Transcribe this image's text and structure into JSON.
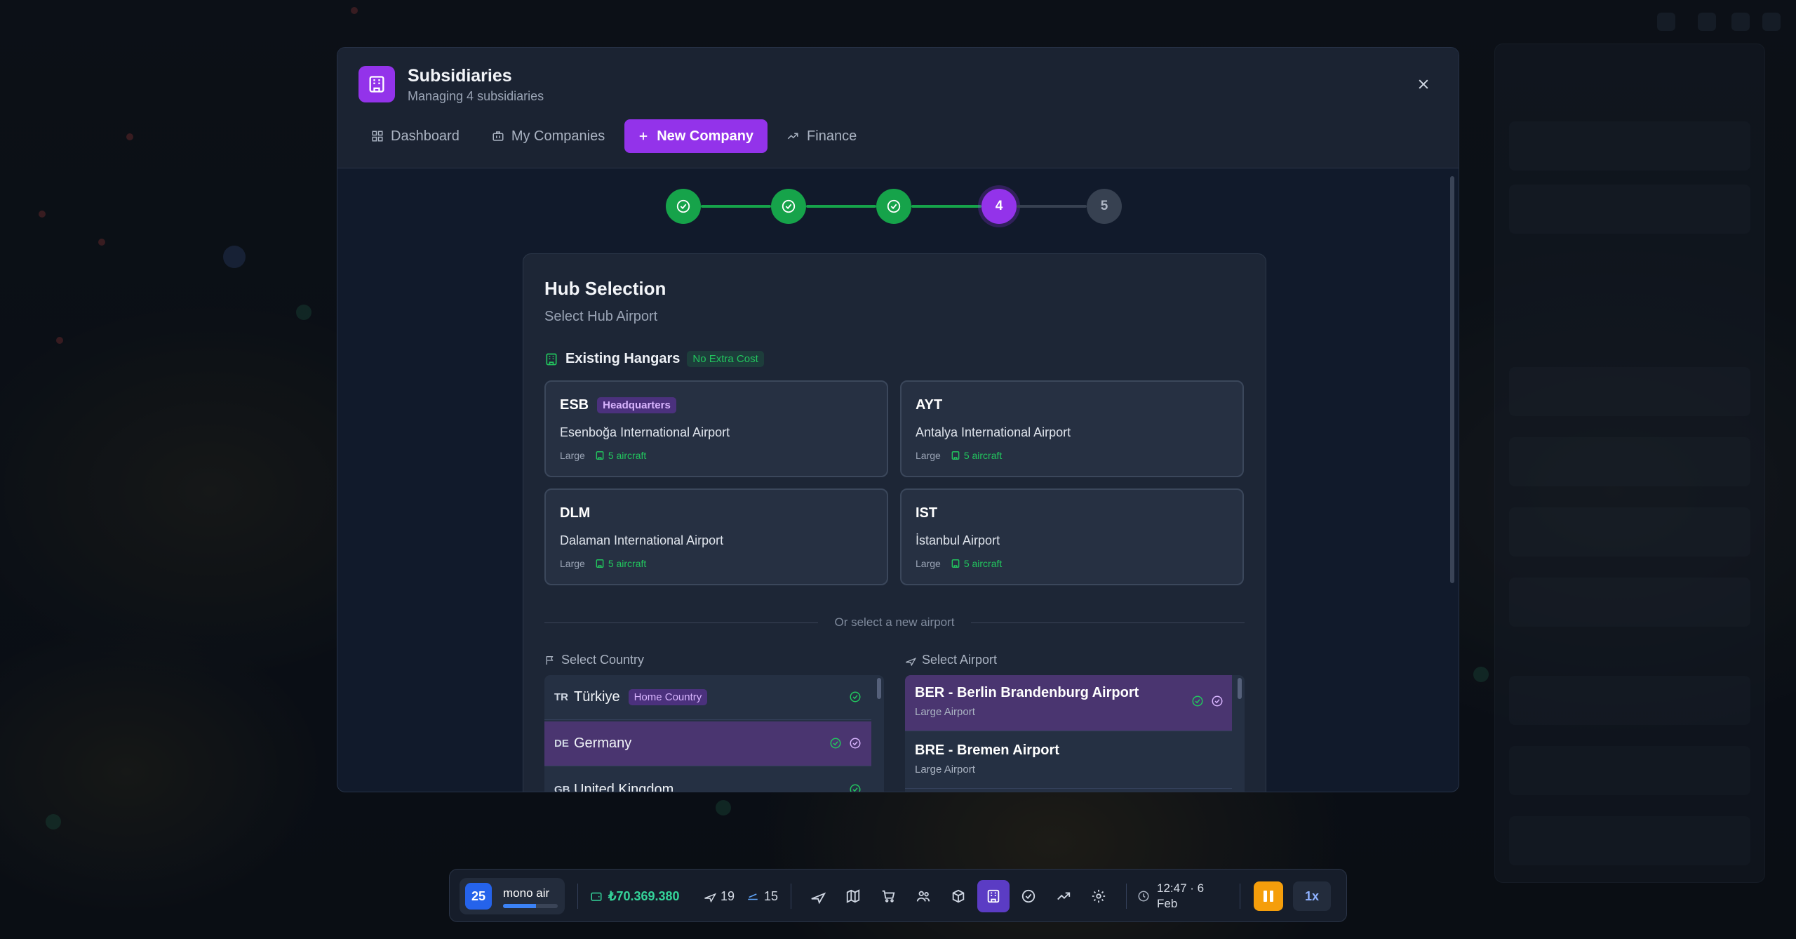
{
  "modal": {
    "title": "Subsidiaries",
    "subtitle": "Managing 4 subsidiaries",
    "tabs": [
      {
        "label": "Dashboard",
        "icon": "grid-icon"
      },
      {
        "label": "My Companies",
        "icon": "briefcase-icon"
      },
      {
        "label": "New Company",
        "icon": "plus-icon",
        "active": true
      },
      {
        "label": "Finance",
        "icon": "trending-up-icon"
      }
    ]
  },
  "stepper": {
    "steps": [
      "1",
      "2",
      "3",
      "4",
      "5"
    ],
    "current": 4
  },
  "hub": {
    "title": "Hub Selection",
    "subtitle": "Select Hub Airport",
    "existing_label": "Existing Hangars",
    "existing_badge": "No Extra Cost",
    "hangars": [
      {
        "code": "ESB",
        "badge": "Headquarters",
        "name": "Esenboğa International Airport",
        "size": "Large",
        "aircraft": "5 aircraft"
      },
      {
        "code": "AYT",
        "badge": "",
        "name": "Antalya International Airport",
        "size": "Large",
        "aircraft": "5 aircraft"
      },
      {
        "code": "DLM",
        "badge": "",
        "name": "Dalaman International Airport",
        "size": "Large",
        "aircraft": "5 aircraft"
      },
      {
        "code": "IST",
        "badge": "",
        "name": "İstanbul Airport",
        "size": "Large",
        "aircraft": "5 aircraft"
      }
    ],
    "divider_text": "Or select a new airport",
    "country_label": "Select Country",
    "airport_label": "Select Airport",
    "countries": [
      {
        "cc": "TR",
        "name": "Türkiye",
        "badge": "Home Country"
      },
      {
        "cc": "DE",
        "name": "Germany",
        "badge": "",
        "selected": true
      },
      {
        "cc": "GB",
        "name": "United Kingdom",
        "badge": ""
      }
    ],
    "airports": [
      {
        "name": "BER - Berlin Brandenburg Airport",
        "type": "Large Airport",
        "selected": true
      },
      {
        "name": "BRE - Bremen Airport",
        "type": "Large Airport"
      }
    ]
  },
  "bottombar": {
    "level": "25",
    "company": "mono air",
    "xp_progress": 0.6,
    "money": "₺70.369.380",
    "aircraft_count": "19",
    "flights_count": "15",
    "time": "12:47 · 6",
    "date": "Feb",
    "speed": "1x",
    "tools": [
      "plane-icon",
      "map-icon",
      "cart-icon",
      "users-icon",
      "box-icon",
      "building-icon",
      "check-circle-icon",
      "trending-up-icon",
      "gear-icon"
    ]
  },
  "colors": {
    "accent": "#9333ea",
    "success": "#16a34a",
    "money": "#34d399",
    "pause": "#f59e0b"
  }
}
